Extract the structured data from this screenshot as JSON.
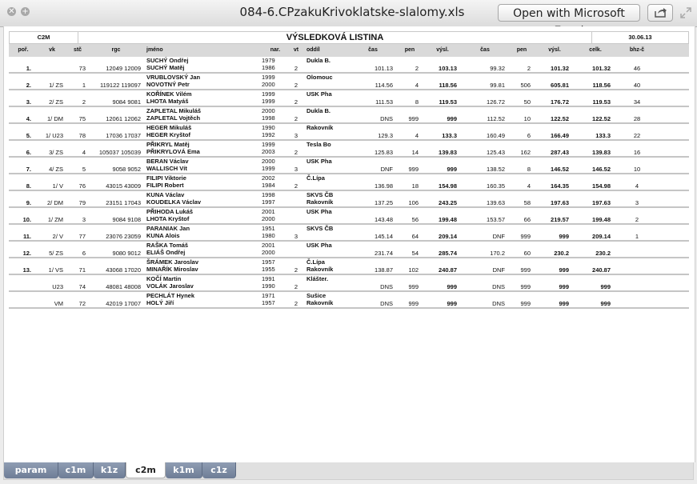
{
  "window": {
    "title": "084-6.CPzakuKrivoklatske-slalomy.xls",
    "open_button": "Open with Microsoft Excel"
  },
  "sheet": {
    "category": "C2M",
    "heading": "VÝSLEDKOVÁ LISTINA",
    "date": "30.06.13",
    "columns": [
      "poř.",
      "vk",
      "stč",
      "rgc",
      "jméno",
      "nar.",
      "vt",
      "oddíl",
      "čas",
      "pen",
      "výsl.",
      "čas",
      "pen",
      "výsl.",
      "celk.",
      "bhz-č"
    ],
    "rows": [
      {
        "por": "1.",
        "vk": "",
        "stc": "73",
        "rgc": "12049 12009",
        "names": [
          "SUCHÝ Ondřej",
          "SUCHÝ Matěj"
        ],
        "nar": [
          "1979",
          "1986"
        ],
        "vt": "2",
        "oddil": [
          "Dukla B.",
          ""
        ],
        "cas1": "101.13",
        "pen1": "2",
        "vysl1": "103.13",
        "cas2": "99.32",
        "pen2": "2",
        "vysl2": "101.32",
        "celk": "101.32",
        "bhz": "46"
      },
      {
        "por": "2.",
        "vk": "1/ ZS",
        "stc": "1",
        "rgc": "119122 119097",
        "names": [
          "VRUBLOVSKÝ Jan",
          "NOVOTNÝ Petr"
        ],
        "nar": [
          "1999",
          "2000"
        ],
        "vt": "2",
        "oddil": [
          "Olomouc",
          ""
        ],
        "cas1": "114.56",
        "pen1": "4",
        "vysl1": "118.56",
        "cas2": "99.81",
        "pen2": "506",
        "vysl2": "605.81",
        "celk": "118.56",
        "bhz": "40"
      },
      {
        "por": "3.",
        "vk": "2/ ZS",
        "stc": "2",
        "rgc": "9084 9081",
        "names": [
          "KOŘÍNEK Vilém",
          "LHOTA Matyáš"
        ],
        "nar": [
          "1999",
          "1999"
        ],
        "vt": "2",
        "oddil": [
          "USK Pha",
          ""
        ],
        "cas1": "111.53",
        "pen1": "8",
        "vysl1": "119.53",
        "cas2": "126.72",
        "pen2": "50",
        "vysl2": "176.72",
        "celk": "119.53",
        "bhz": "34"
      },
      {
        "por": "4.",
        "vk": "1/ DM",
        "stc": "75",
        "rgc": "12061 12062",
        "names": [
          "ZAPLETAL Mikuláš",
          "ZAPLETAL Vojtěch"
        ],
        "nar": [
          "2000",
          "1998"
        ],
        "vt": "2",
        "oddil": [
          "Dukla B.",
          ""
        ],
        "cas1": "DNS",
        "pen1": "999",
        "vysl1": "999",
        "cas2": "112.52",
        "pen2": "10",
        "vysl2": "122.52",
        "celk": "122.52",
        "bhz": "28"
      },
      {
        "por": "5.",
        "vk": "1/ U23",
        "stc": "78",
        "rgc": "17036 17037",
        "names": [
          "HEGER Mikuláš",
          "HEGER Kryštof"
        ],
        "nar": [
          "1990",
          "1992"
        ],
        "vt": "3",
        "oddil": [
          "Rakovník",
          ""
        ],
        "cas1": "129.3",
        "pen1": "4",
        "vysl1": "133.3",
        "cas2": "160.49",
        "pen2": "6",
        "vysl2": "166.49",
        "celk": "133.3",
        "bhz": "22"
      },
      {
        "por": "6.",
        "vk": "3/ ZS",
        "stc": "4",
        "rgc": "105037 105039",
        "names": [
          "PŘIKRYL Matěj",
          "PŘIKRYLOVÁ Ema"
        ],
        "nar": [
          "1999",
          "2003"
        ],
        "vt": "2",
        "oddil": [
          "Tesla Bo",
          ""
        ],
        "cas1": "125.83",
        "pen1": "14",
        "vysl1": "139.83",
        "cas2": "125.43",
        "pen2": "162",
        "vysl2": "287.43",
        "celk": "139.83",
        "bhz": "16"
      },
      {
        "por": "7.",
        "vk": "4/ ZS",
        "stc": "5",
        "rgc": "9058 9052",
        "names": [
          "BERAN Václav",
          "WALLISCH Vít"
        ],
        "nar": [
          "2000",
          "1999"
        ],
        "vt": "3",
        "oddil": [
          "USK Pha",
          ""
        ],
        "cas1": "DNF",
        "pen1": "999",
        "vysl1": "999",
        "cas2": "138.52",
        "pen2": "8",
        "vysl2": "146.52",
        "celk": "146.52",
        "bhz": "10"
      },
      {
        "por": "8.",
        "vk": "1/ V",
        "stc": "76",
        "rgc": "43015 43009",
        "names": [
          "FILIPI Viktorie",
          "FILIPI Robert"
        ],
        "nar": [
          "2002",
          "1984"
        ],
        "vt": "2",
        "oddil": [
          "Č.Lípa",
          ""
        ],
        "cas1": "136.98",
        "pen1": "18",
        "vysl1": "154.98",
        "cas2": "160.35",
        "pen2": "4",
        "vysl2": "164.35",
        "celk": "154.98",
        "bhz": "4"
      },
      {
        "por": "9.",
        "vk": "2/ DM",
        "stc": "79",
        "rgc": "23151 17043",
        "names": [
          "KUNA Václav",
          "KOUDELKA Václav"
        ],
        "nar": [
          "1998",
          "1997"
        ],
        "vt": "",
        "oddil": [
          "SKVS ČB",
          "Rakovník"
        ],
        "cas1": "137.25",
        "pen1": "106",
        "vysl1": "243.25",
        "cas2": "139.63",
        "pen2": "58",
        "vysl2": "197.63",
        "celk": "197.63",
        "bhz": "3"
      },
      {
        "por": "10.",
        "vk": "1/ ZM",
        "stc": "3",
        "rgc": "9084 9108",
        "names": [
          "PŘIHODA Lukáš",
          "LHOTA Kryštof"
        ],
        "nar": [
          "2001",
          "2000"
        ],
        "vt": "",
        "oddil": [
          "USK Pha",
          ""
        ],
        "cas1": "143.48",
        "pen1": "56",
        "vysl1": "199.48",
        "cas2": "153.57",
        "pen2": "66",
        "vysl2": "219.57",
        "celk": "199.48",
        "bhz": "2"
      },
      {
        "por": "11.",
        "vk": "2/ V",
        "stc": "77",
        "rgc": "23076 23059",
        "names": [
          "PARANIAK Jan",
          "KUNA Alois"
        ],
        "nar": [
          "1951",
          "1980"
        ],
        "vt": "3",
        "oddil": [
          "SKVS ČB",
          ""
        ],
        "cas1": "145.14",
        "pen1": "64",
        "vysl1": "209.14",
        "cas2": "DNF",
        "pen2": "999",
        "vysl2": "999",
        "celk": "209.14",
        "bhz": "1"
      },
      {
        "por": "12.",
        "vk": "5/ ZS",
        "stc": "6",
        "rgc": "9080 9012",
        "names": [
          "RAŠKA Tomáš",
          "ELIÁŠ Ondřej"
        ],
        "nar": [
          "2001",
          "2000"
        ],
        "vt": "",
        "oddil": [
          "USK Pha",
          ""
        ],
        "cas1": "231.74",
        "pen1": "54",
        "vysl1": "285.74",
        "cas2": "170.2",
        "pen2": "60",
        "vysl2": "230.2",
        "celk": "230.2",
        "bhz": ""
      },
      {
        "por": "13.",
        "vk": "1/ VS",
        "stc": "71",
        "rgc": "43068 17020",
        "names": [
          "ŠRÁMEK Jaroslav",
          "MINAŘÍK Miroslav"
        ],
        "nar": [
          "1957",
          "1955"
        ],
        "vt": "2",
        "oddil": [
          "Č.Lípa",
          "Rakovník"
        ],
        "cas1": "138.87",
        "pen1": "102",
        "vysl1": "240.87",
        "cas2": "DNF",
        "pen2": "999",
        "vysl2": "999",
        "celk": "240.87",
        "bhz": ""
      },
      {
        "por": "",
        "vk": "U23",
        "stc": "74",
        "rgc": "48081 48008",
        "names": [
          "KOČÍ Martin",
          "VOLÁK Jaroslav"
        ],
        "nar": [
          "1991",
          "1990"
        ],
        "vt": "2",
        "oddil": [
          "Klášter.",
          ""
        ],
        "cas1": "DNS",
        "pen1": "999",
        "vysl1": "999",
        "cas2": "DNS",
        "pen2": "999",
        "vysl2": "999",
        "celk": "999",
        "bhz": ""
      },
      {
        "por": "",
        "vk": "VM",
        "stc": "72",
        "rgc": "42019 17007",
        "names": [
          "PECHLÁT Hynek",
          "HOLÝ Jiří"
        ],
        "nar": [
          "1971",
          "1957"
        ],
        "vt": "2",
        "oddil": [
          "Sušice",
          "Rakovník"
        ],
        "cas1": "DNS",
        "pen1": "999",
        "vysl1": "999",
        "cas2": "DNS",
        "pen2": "999",
        "vysl2": "999",
        "celk": "999",
        "bhz": ""
      }
    ]
  },
  "tabs": [
    "param",
    "c1m",
    "k1z",
    "c2m",
    "k1m",
    "c1z"
  ],
  "active_tab": "c2m"
}
